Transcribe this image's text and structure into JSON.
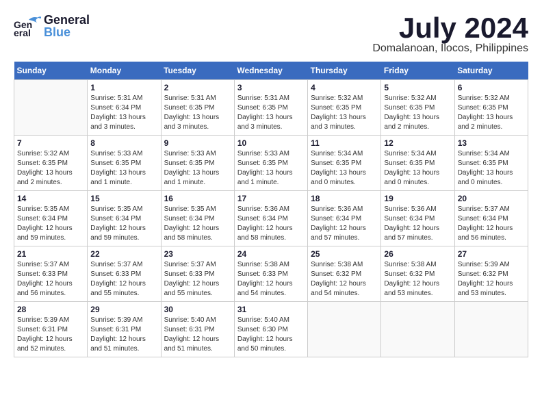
{
  "header": {
    "logo_line1": "General",
    "logo_line2": "Blue",
    "title": "July 2024",
    "location": "Domalanoan, Ilocos, Philippines"
  },
  "weekdays": [
    "Sunday",
    "Monday",
    "Tuesday",
    "Wednesday",
    "Thursday",
    "Friday",
    "Saturday"
  ],
  "weeks": [
    [
      {
        "day": "",
        "info": ""
      },
      {
        "day": "1",
        "info": "Sunrise: 5:31 AM\nSunset: 6:34 PM\nDaylight: 13 hours\nand 3 minutes."
      },
      {
        "day": "2",
        "info": "Sunrise: 5:31 AM\nSunset: 6:35 PM\nDaylight: 13 hours\nand 3 minutes."
      },
      {
        "day": "3",
        "info": "Sunrise: 5:31 AM\nSunset: 6:35 PM\nDaylight: 13 hours\nand 3 minutes."
      },
      {
        "day": "4",
        "info": "Sunrise: 5:32 AM\nSunset: 6:35 PM\nDaylight: 13 hours\nand 3 minutes."
      },
      {
        "day": "5",
        "info": "Sunrise: 5:32 AM\nSunset: 6:35 PM\nDaylight: 13 hours\nand 2 minutes."
      },
      {
        "day": "6",
        "info": "Sunrise: 5:32 AM\nSunset: 6:35 PM\nDaylight: 13 hours\nand 2 minutes."
      }
    ],
    [
      {
        "day": "7",
        "info": "Sunrise: 5:32 AM\nSunset: 6:35 PM\nDaylight: 13 hours\nand 2 minutes."
      },
      {
        "day": "8",
        "info": "Sunrise: 5:33 AM\nSunset: 6:35 PM\nDaylight: 13 hours\nand 1 minute."
      },
      {
        "day": "9",
        "info": "Sunrise: 5:33 AM\nSunset: 6:35 PM\nDaylight: 13 hours\nand 1 minute."
      },
      {
        "day": "10",
        "info": "Sunrise: 5:33 AM\nSunset: 6:35 PM\nDaylight: 13 hours\nand 1 minute."
      },
      {
        "day": "11",
        "info": "Sunrise: 5:34 AM\nSunset: 6:35 PM\nDaylight: 13 hours\nand 0 minutes."
      },
      {
        "day": "12",
        "info": "Sunrise: 5:34 AM\nSunset: 6:35 PM\nDaylight: 13 hours\nand 0 minutes."
      },
      {
        "day": "13",
        "info": "Sunrise: 5:34 AM\nSunset: 6:35 PM\nDaylight: 13 hours\nand 0 minutes."
      }
    ],
    [
      {
        "day": "14",
        "info": "Sunrise: 5:35 AM\nSunset: 6:34 PM\nDaylight: 12 hours\nand 59 minutes."
      },
      {
        "day": "15",
        "info": "Sunrise: 5:35 AM\nSunset: 6:34 PM\nDaylight: 12 hours\nand 59 minutes."
      },
      {
        "day": "16",
        "info": "Sunrise: 5:35 AM\nSunset: 6:34 PM\nDaylight: 12 hours\nand 58 minutes."
      },
      {
        "day": "17",
        "info": "Sunrise: 5:36 AM\nSunset: 6:34 PM\nDaylight: 12 hours\nand 58 minutes."
      },
      {
        "day": "18",
        "info": "Sunrise: 5:36 AM\nSunset: 6:34 PM\nDaylight: 12 hours\nand 57 minutes."
      },
      {
        "day": "19",
        "info": "Sunrise: 5:36 AM\nSunset: 6:34 PM\nDaylight: 12 hours\nand 57 minutes."
      },
      {
        "day": "20",
        "info": "Sunrise: 5:37 AM\nSunset: 6:34 PM\nDaylight: 12 hours\nand 56 minutes."
      }
    ],
    [
      {
        "day": "21",
        "info": "Sunrise: 5:37 AM\nSunset: 6:33 PM\nDaylight: 12 hours\nand 56 minutes."
      },
      {
        "day": "22",
        "info": "Sunrise: 5:37 AM\nSunset: 6:33 PM\nDaylight: 12 hours\nand 55 minutes."
      },
      {
        "day": "23",
        "info": "Sunrise: 5:37 AM\nSunset: 6:33 PM\nDaylight: 12 hours\nand 55 minutes."
      },
      {
        "day": "24",
        "info": "Sunrise: 5:38 AM\nSunset: 6:33 PM\nDaylight: 12 hours\nand 54 minutes."
      },
      {
        "day": "25",
        "info": "Sunrise: 5:38 AM\nSunset: 6:32 PM\nDaylight: 12 hours\nand 54 minutes."
      },
      {
        "day": "26",
        "info": "Sunrise: 5:38 AM\nSunset: 6:32 PM\nDaylight: 12 hours\nand 53 minutes."
      },
      {
        "day": "27",
        "info": "Sunrise: 5:39 AM\nSunset: 6:32 PM\nDaylight: 12 hours\nand 53 minutes."
      }
    ],
    [
      {
        "day": "28",
        "info": "Sunrise: 5:39 AM\nSunset: 6:31 PM\nDaylight: 12 hours\nand 52 minutes."
      },
      {
        "day": "29",
        "info": "Sunrise: 5:39 AM\nSunset: 6:31 PM\nDaylight: 12 hours\nand 51 minutes."
      },
      {
        "day": "30",
        "info": "Sunrise: 5:40 AM\nSunset: 6:31 PM\nDaylight: 12 hours\nand 51 minutes."
      },
      {
        "day": "31",
        "info": "Sunrise: 5:40 AM\nSunset: 6:30 PM\nDaylight: 12 hours\nand 50 minutes."
      },
      {
        "day": "",
        "info": ""
      },
      {
        "day": "",
        "info": ""
      },
      {
        "day": "",
        "info": ""
      }
    ]
  ]
}
